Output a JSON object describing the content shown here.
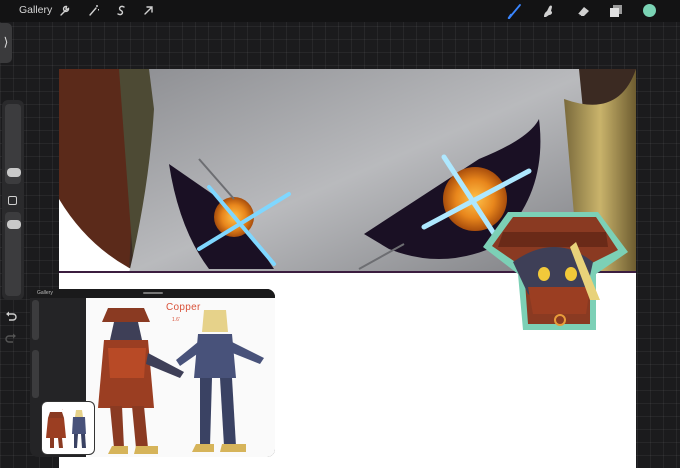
{
  "topbar": {
    "gallery_label": "Gallery",
    "left_tools": [
      "wrench-icon",
      "magic-wand-icon",
      "selection-icon",
      "transform-arrow-icon"
    ],
    "right_tools": [
      "brush-icon",
      "smudge-icon",
      "eraser-icon",
      "layers-icon"
    ],
    "active_color": "#7ad3b4",
    "active_tool_color": "#3a86ff"
  },
  "sidebar": {
    "toggle_glyph": "⟩",
    "undo_glyph": "undo",
    "redo_glyph": "redo"
  },
  "canvas": {
    "background": "#ffffff",
    "divider_color": "#3b1d3f"
  },
  "reference_window": {
    "title_bar_label": "Gallery",
    "character_name": "Copper",
    "character_sub": "1.6'"
  }
}
